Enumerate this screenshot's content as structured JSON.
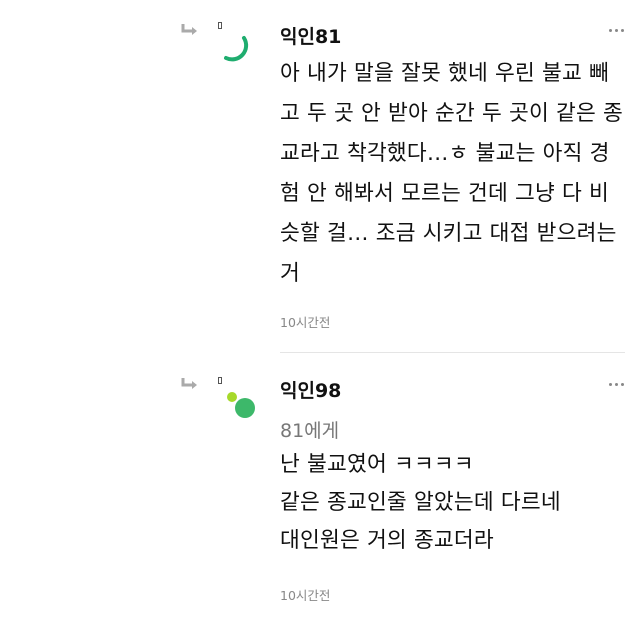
{
  "comments": [
    {
      "nickname": "익인81",
      "mention": "",
      "lines": [
        "아 내가 말을 잘못 했네 우린 불교 빼",
        "고 두 곳 안 받아 순간 두 곳이 같은 종",
        "교라고 착각했다…ㅎ 불교는 아직 경",
        "험 안 해봐서 모르는 건데 그냥 다 비",
        "슷할 걸… 조금 시키고 대접 받으려는",
        "거"
      ],
      "time": "10시간전",
      "avatar_color": "#1fad6f"
    },
    {
      "nickname": "익인98",
      "mention": "81에게",
      "lines": [
        "난 불교였어 ㅋㅋㅋㅋ",
        "같은 종교인줄 알았는데 다르네",
        "대인원은 거의 종교더라"
      ],
      "time": "10시간전",
      "avatar_color": "#3db86a",
      "avatar_dot_color": "#a6d92a"
    }
  ],
  "icons": {
    "reply": "reply-arrow-icon",
    "more": "more-dots-icon"
  }
}
